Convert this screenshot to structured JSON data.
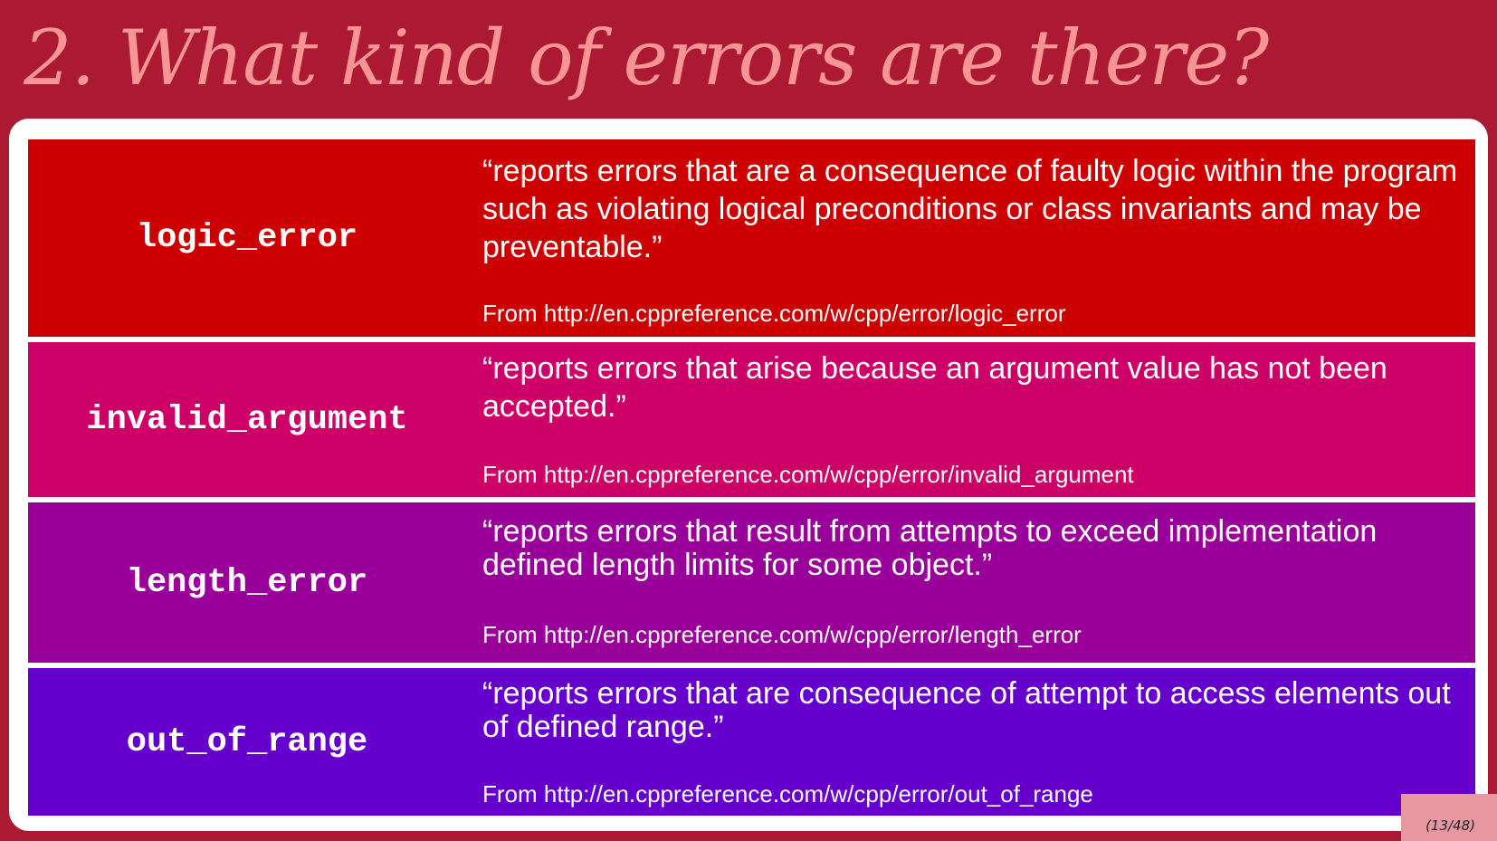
{
  "slide": {
    "title": "2. What kind of errors are there?",
    "page_number": "(13/48)"
  },
  "colors": {
    "background": "#ab1a32",
    "title": "#f79595",
    "logic_error": "#cc0000",
    "invalid_argument": "#cc0066",
    "length_error": "#990099",
    "out_of_range": "#6600cc"
  },
  "rows": [
    {
      "name": "logic_error",
      "description": "“reports errors that are a consequence of faulty logic within the program such as violating logical preconditions or class invariants and may be preventable.”",
      "source": "From http://en.cppreference.com/w/cpp/error/logic_error"
    },
    {
      "name": "invalid_argument",
      "description": "“reports errors that arise because an argument value has not been accepted.”",
      "source": "From http://en.cppreference.com/w/cpp/error/invalid_argument"
    },
    {
      "name": "length_error",
      "description": "“reports errors that result from attempts to exceed implementation defined length limits for some object.”",
      "source": "From http://en.cppreference.com/w/cpp/error/length_error"
    },
    {
      "name": "out_of_range",
      "description": "“reports errors that are consequence of attempt to access elements out of defined range.”",
      "source": "From http://en.cppreference.com/w/cpp/error/out_of_range"
    }
  ]
}
